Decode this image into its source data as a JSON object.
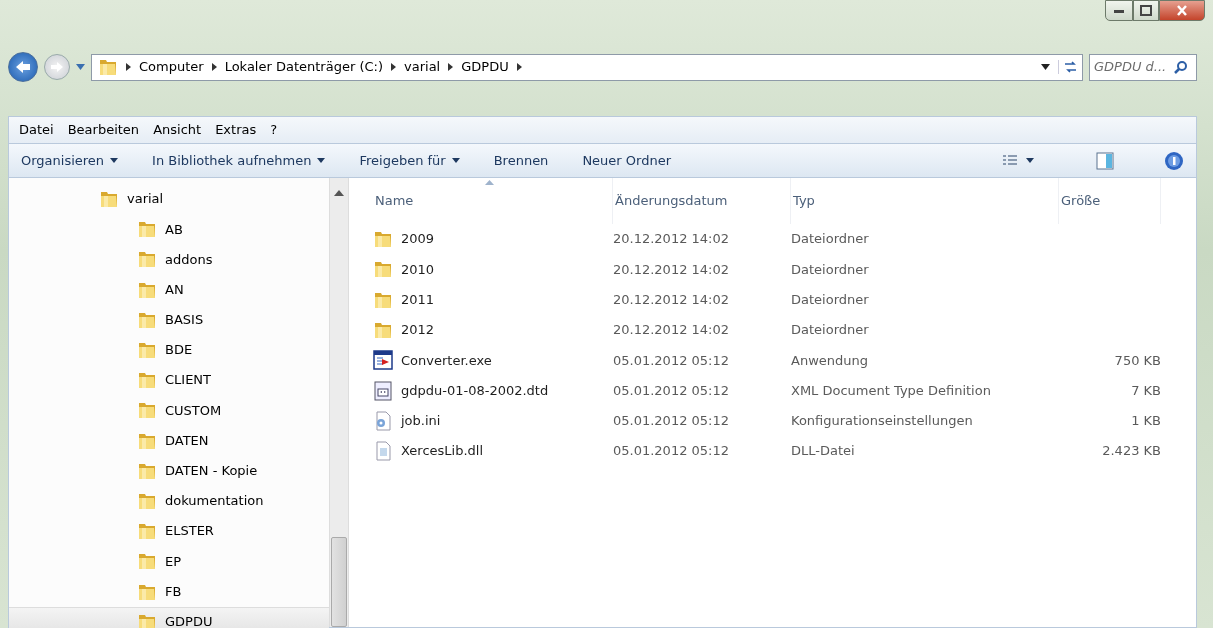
{
  "address_bar": {
    "path": [
      {
        "label": "Computer"
      },
      {
        "label": "Lokaler Datenträger (C:)"
      },
      {
        "label": "varial"
      },
      {
        "label": "GDPDU"
      }
    ],
    "search": {
      "placeholder": "GDPDU d..."
    }
  },
  "menu_bar": [
    "Datei",
    "Bearbeiten",
    "Ansicht",
    "Extras",
    "?"
  ],
  "toolbar": [
    {
      "label": "Organisieren",
      "dropdown": true
    },
    {
      "label": "In Bibliothek aufnehmen",
      "dropdown": true
    },
    {
      "label": "Freigeben für",
      "dropdown": true
    },
    {
      "label": "Brennen",
      "dropdown": false
    },
    {
      "label": "Neuer Ordner",
      "dropdown": false
    }
  ],
  "sidebar": {
    "items": [
      {
        "label": "varial",
        "selected": false,
        "children": [
          {
            "label": "AB",
            "selected": false
          },
          {
            "label": "addons",
            "selected": false
          },
          {
            "label": "AN",
            "selected": false
          },
          {
            "label": "BASIS",
            "selected": false
          },
          {
            "label": "BDE",
            "selected": false
          },
          {
            "label": "CLIENT",
            "selected": false
          },
          {
            "label": "CUSTOM",
            "selected": false
          },
          {
            "label": "DATEN",
            "selected": false
          },
          {
            "label": "DATEN - Kopie",
            "selected": false
          },
          {
            "label": "dokumentation",
            "selected": false
          },
          {
            "label": "ELSTER",
            "selected": false
          },
          {
            "label": "EP",
            "selected": false
          },
          {
            "label": "FB",
            "selected": false
          },
          {
            "label": "GDPDU",
            "selected": true
          }
        ]
      }
    ]
  },
  "table": {
    "columns": [
      {
        "label": "Name",
        "sorted": true
      },
      {
        "label": "Änderungsdatum",
        "sorted": false
      },
      {
        "label": "Typ",
        "sorted": false
      },
      {
        "label": "Größe",
        "sorted": false
      }
    ],
    "rows": [
      {
        "kind": "folder",
        "name": "2009",
        "date": "20.12.2012 14:02",
        "type": "Dateiordner"
      },
      {
        "kind": "folder",
        "name": "2010",
        "date": "20.12.2012 14:02",
        "type": "Dateiordner"
      },
      {
        "kind": "folder",
        "name": "2011",
        "date": "20.12.2012 14:02",
        "type": "Dateiordner"
      },
      {
        "kind": "folder",
        "name": "2012",
        "date": "20.12.2012 14:02",
        "type": "Dateiordner"
      },
      {
        "kind": "exe",
        "name": "Converter.exe",
        "date": "05.01.2012 05:12",
        "type": "Anwendung",
        "size": "750 KB"
      },
      {
        "kind": "dtd",
        "name": "gdpdu-01-08-2002.dtd",
        "date": "05.01.2012 05:12",
        "type": "XML Document Type Definition",
        "size": "7 KB"
      },
      {
        "kind": "ini",
        "name": "job.ini",
        "date": "05.01.2012 05:12",
        "type": "Konfigurationseinstellungen",
        "size": "1 KB"
      },
      {
        "kind": "dll",
        "name": "XercesLib.dll",
        "date": "05.01.2012 05:12",
        "type": "DLL-Datei",
        "size": "2.423 KB"
      }
    ]
  }
}
